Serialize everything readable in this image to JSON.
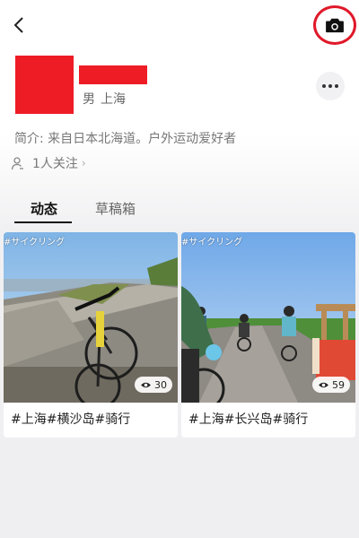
{
  "profile": {
    "gender": "男",
    "location": "上海",
    "bio": "简介: 来自日本北海道。户外运动爱好者",
    "follow_text": "1人关注",
    "follow_chevron": "›"
  },
  "tabs": [
    {
      "label": "动态",
      "active": true
    },
    {
      "label": "草稿箱",
      "active": false
    }
  ],
  "posts": [
    {
      "overlay_tag": "#サイクリング",
      "views": "30",
      "caption": "#上海#横沙岛#骑行"
    },
    {
      "overlay_tag": "#サイクリング",
      "views": "59",
      "caption": "#上海#长兴岛#骑行"
    }
  ],
  "icons": {
    "back": "chevron-left-icon",
    "camera": "camera-icon",
    "more": "more-dots-icon",
    "follow": "person-icon",
    "views": "eye-icon"
  },
  "colors": {
    "redaction": "#ee1c25",
    "camera_highlight": "#e0192a",
    "background": "#efeff1",
    "card": "#ffffff"
  }
}
